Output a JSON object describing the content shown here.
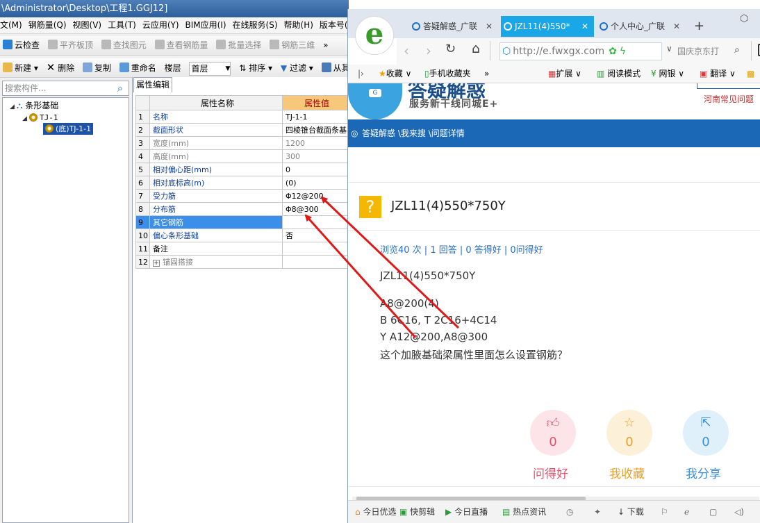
{
  "app": {
    "title": "\\Administrator\\Desktop\\工程1.GGJ12]",
    "menu": [
      "文(M)",
      "钢筋量(Q)",
      "视图(V)",
      "工具(T)",
      "云应用(Y)",
      "BIM应用(I)",
      "在线服务(S)",
      "帮助(H)",
      "版本号(B"
    ],
    "toolbar1": [
      "云检查",
      "平齐板顶",
      "查找图元",
      "查看钢筋量",
      "批量选择",
      "钢筋三维",
      "»"
    ],
    "toolbar2": [
      "新建",
      "删除",
      "复制",
      "重命名",
      "楼层",
      "首层",
      "排序",
      "过滤",
      "从其"
    ],
    "search_placeholder": "搜索构件...",
    "tree": {
      "root": "条形基础",
      "child": "TJ-1",
      "leaf": "(底)TJ-1-1"
    },
    "panel_tab": "属性编辑",
    "grid": {
      "headers": [
        "属性名称",
        "属性值"
      ],
      "rows": [
        {
          "n": "1",
          "name": "名称",
          "value": "TJ-1-1"
        },
        {
          "n": "2",
          "name": "截面形状",
          "value": "四棱锥台截面条基"
        },
        {
          "n": "3",
          "name": "宽度(mm)",
          "value": "1200"
        },
        {
          "n": "4",
          "name": "高度(mm)",
          "value": "300"
        },
        {
          "n": "5",
          "name": "相对偏心距(mm)",
          "value": "0"
        },
        {
          "n": "6",
          "name": "相对底标高(m)",
          "value": "(0)"
        },
        {
          "n": "7",
          "name": "受力筋",
          "value": "Φ12@200"
        },
        {
          "n": "8",
          "name": "分布筋",
          "value": "Φ8@300"
        },
        {
          "n": "9",
          "name": "其它钢筋",
          "value": ""
        },
        {
          "n": "10",
          "name": "偏心条形基础",
          "value": "否"
        },
        {
          "n": "11",
          "name": "备注",
          "value": ""
        },
        {
          "n": "12",
          "name": "锚固搭接",
          "value": ""
        }
      ]
    }
  },
  "browser": {
    "tabs": [
      "答疑解惑_广联",
      "JZL11(4)550*",
      "个人中心_广联"
    ],
    "new_tab": "+",
    "url": "http://e.fwxgx.com",
    "search_hint": "国庆京东打",
    "bookmarks": [
      "收藏",
      "手机收藏夹",
      "»",
      "扩展",
      "阅读模式",
      "网银",
      "翻译"
    ],
    "site": {
      "logo_text": "答疑解惑",
      "slogan": "服务新干线同城E+",
      "right_link": "河南常见问题",
      "breadcrumb": "答疑解惑 \\我来搜 \\问题详情",
      "question_title": "JZL11(4)550*750Y",
      "stats": "浏览40 次 | 1 回答 | 0 答得好 | 0问得好",
      "body_lines": [
        "JZL11(4)550*750Y",
        "A8@200(4)",
        "B 6C16, T 2C16+4C14",
        "Y A12@200,A8@300",
        "这个加腋基础梁属性里面怎么设置钢筋？"
      ],
      "actions": [
        {
          "label": "问得好",
          "count": "0",
          "color": "#e8506a"
        },
        {
          "label": "我收藏",
          "count": "0",
          "color": "#e8a12a"
        },
        {
          "label": "我分享",
          "count": "0",
          "color": "#3a8fd8"
        }
      ]
    },
    "status": [
      "今日优选",
      "快剪辑",
      "今日直播",
      "热点资讯",
      "下载"
    ]
  }
}
